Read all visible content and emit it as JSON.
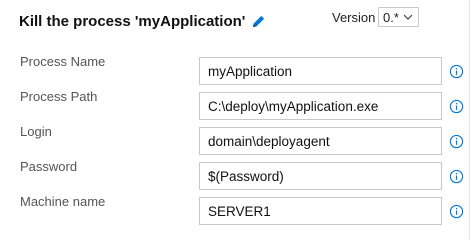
{
  "header": {
    "title": "Kill the process 'myApplication'",
    "edit_icon": "pencil-icon",
    "version_label": "Version",
    "version_value": "0.*"
  },
  "fields": [
    {
      "label": "Process Name",
      "value": "myApplication"
    },
    {
      "label": "Process Path",
      "value": "C:\\deploy\\myApplication.exe"
    },
    {
      "label": "Login",
      "value": "domain\\deployagent"
    },
    {
      "label": "Password",
      "value": "$(Password)"
    },
    {
      "label": "Machine name",
      "value": "SERVER1"
    }
  ],
  "colors": {
    "accent": "#0078d4",
    "border": "#c8c8c8"
  }
}
